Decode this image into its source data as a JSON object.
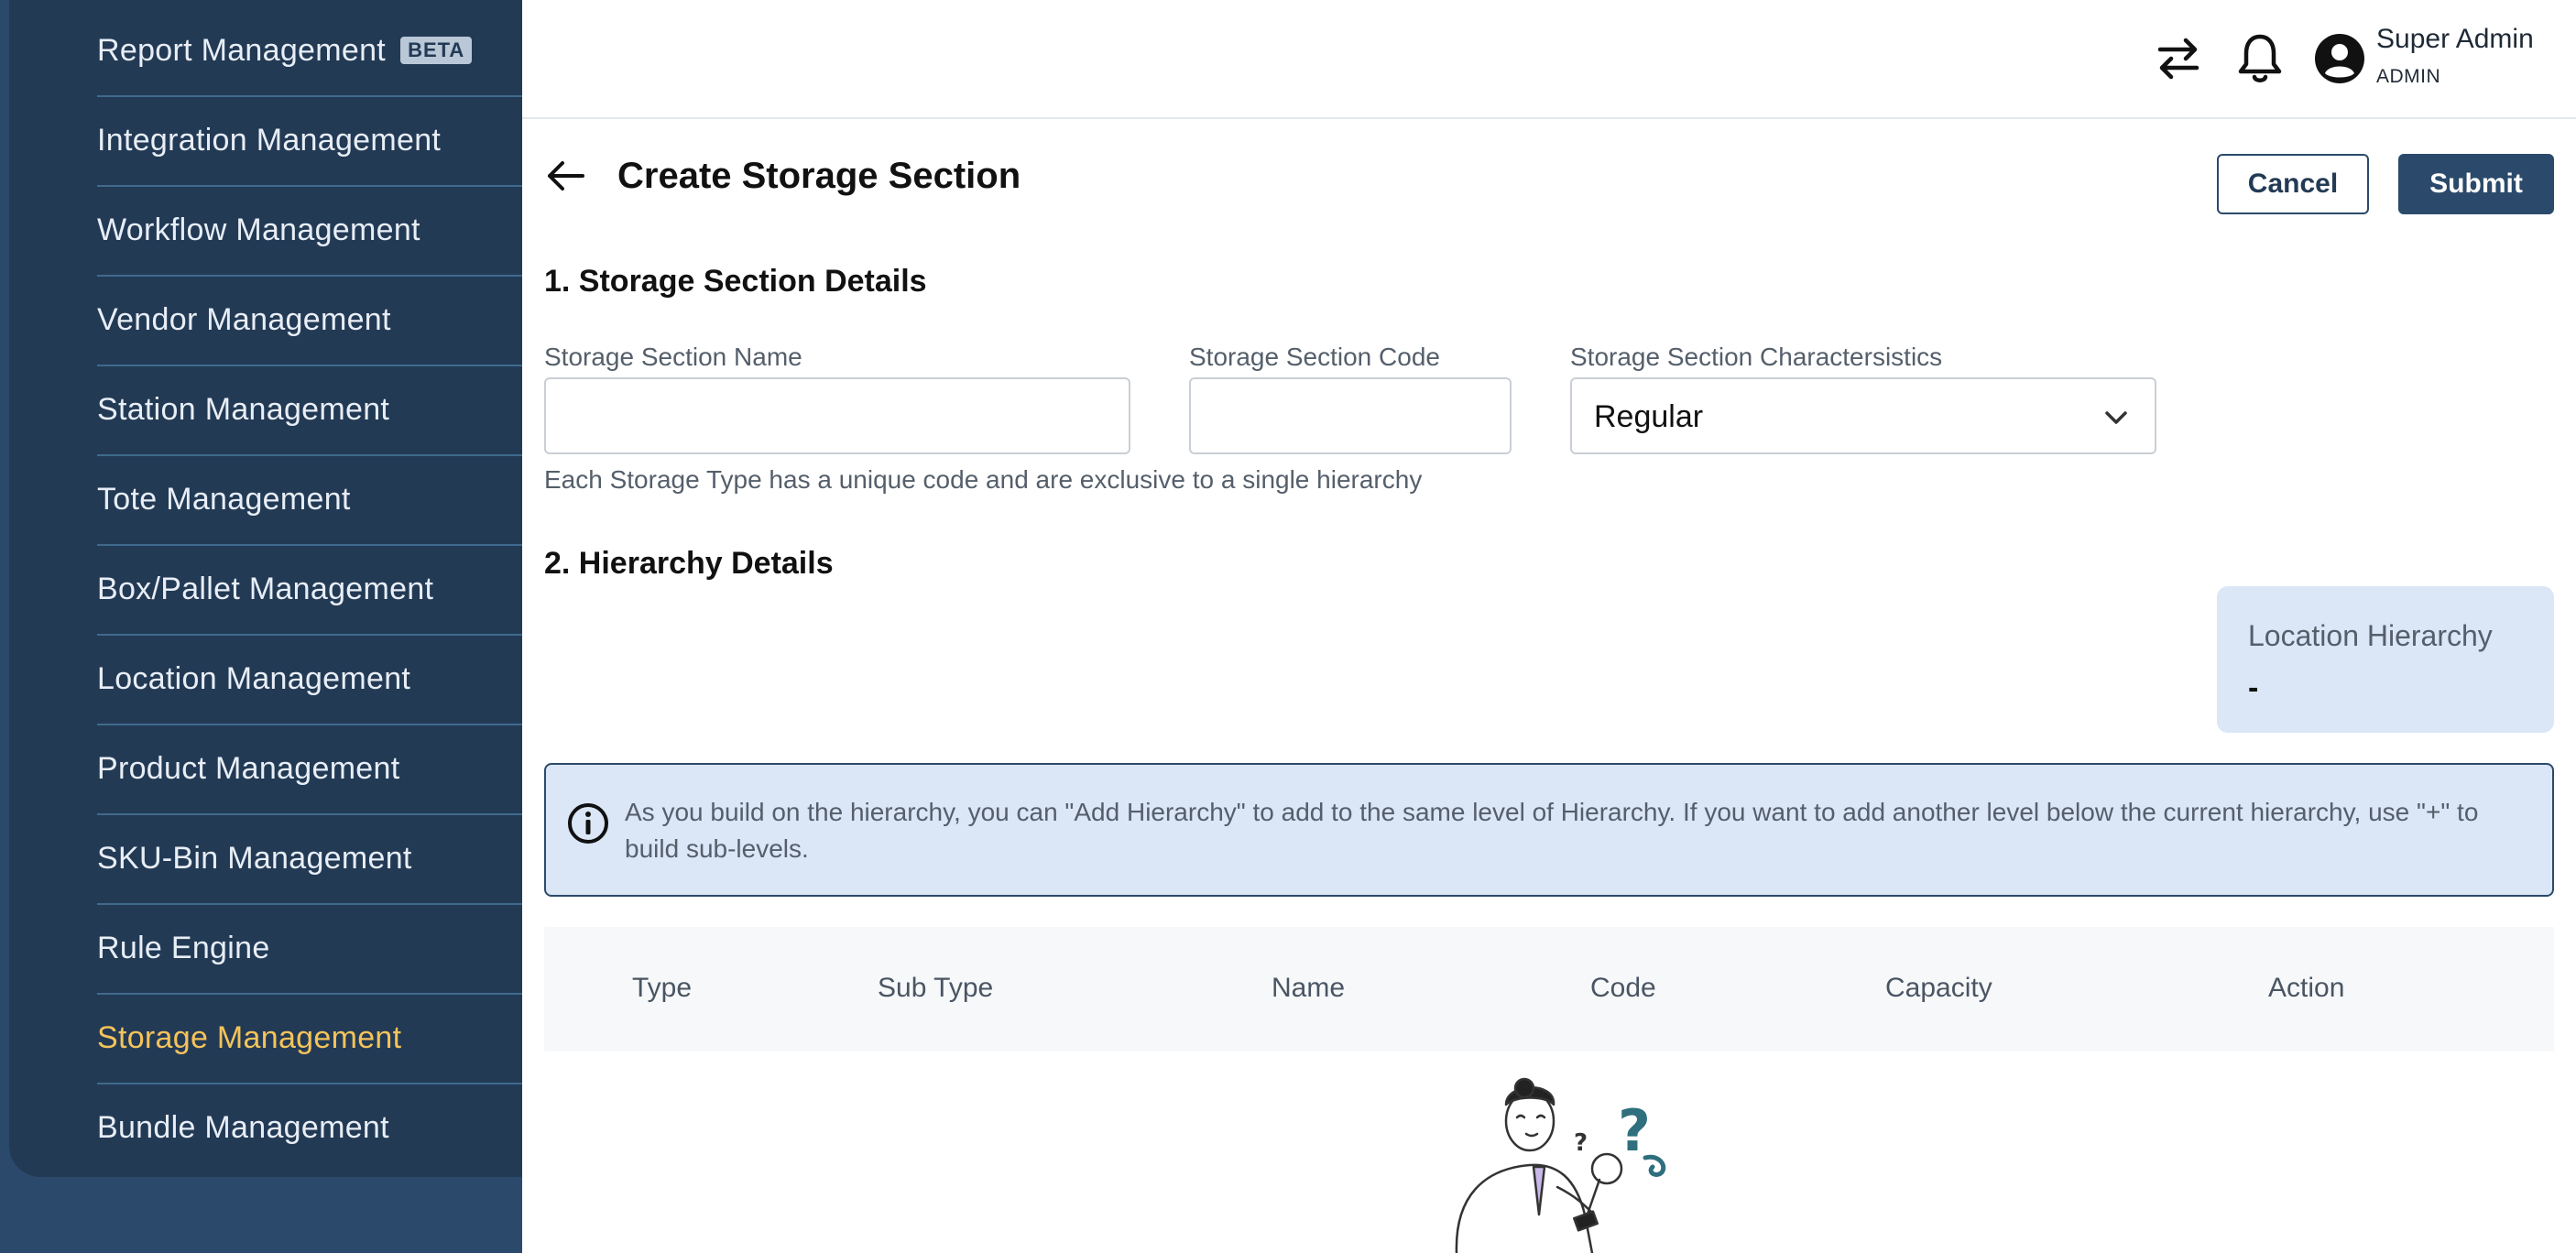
{
  "sidebar": {
    "items": [
      {
        "label": "Report Management",
        "badge": "BETA"
      },
      {
        "label": "Integration Management"
      },
      {
        "label": "Workflow Management"
      },
      {
        "label": "Vendor Management"
      },
      {
        "label": "Station Management"
      },
      {
        "label": "Tote Management"
      },
      {
        "label": "Box/Pallet Management"
      },
      {
        "label": "Location Management"
      },
      {
        "label": "Product Management"
      },
      {
        "label": "SKU-Bin Management"
      },
      {
        "label": "Rule Engine"
      },
      {
        "label": "Storage Management",
        "active": true
      },
      {
        "label": "Bundle Management"
      }
    ]
  },
  "header": {
    "user_name": "Super Admin",
    "user_role": "ADMIN",
    "icons": [
      "swap-icon",
      "bell-icon",
      "user-avatar-icon"
    ]
  },
  "page": {
    "title": "Create Storage Section",
    "cancel_label": "Cancel",
    "submit_label": "Submit"
  },
  "section1": {
    "heading": "1. Storage Section Details",
    "name_label": "Storage Section Name",
    "name_value": "",
    "code_label": "Storage Section Code",
    "code_value": "",
    "char_label": "Storage Section Charactersistics",
    "char_value": "Regular",
    "helper": "Each Storage Type has a unique code and are exclusive to a single hierarchy"
  },
  "section2": {
    "heading": "2. Hierarchy Details",
    "location_title": "Location Hierarchy",
    "location_value": "-",
    "info": "As you build on the hierarchy, you can \"Add Hierarchy\" to add to the same level of Hierarchy. If you want to add another level below the current hierarchy, use \"+\" to build sub-levels."
  },
  "table": {
    "columns": [
      "Type",
      "Sub Type",
      "Name",
      "Code",
      "Capacity",
      "Action"
    ]
  },
  "colors": {
    "sidebar": "#233a55",
    "accent": "#2b4a6b",
    "active_nav": "#f4c35a",
    "info_bg": "#dbe6f6"
  }
}
